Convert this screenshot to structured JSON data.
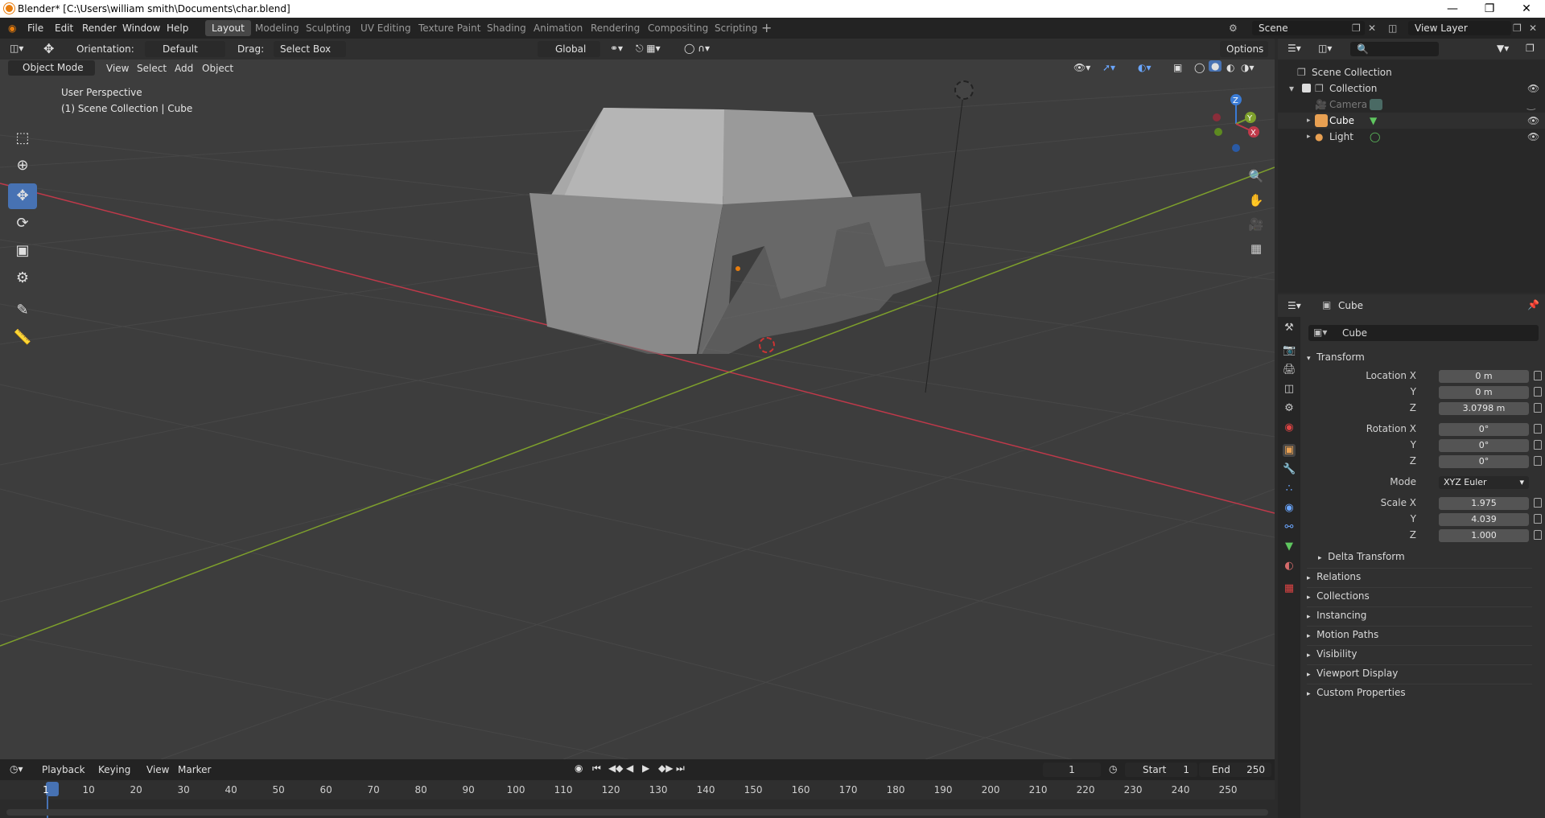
{
  "window": {
    "title": "Blender* [C:\\Users\\william smith\\Documents\\char.blend]"
  },
  "menu": [
    "File",
    "Edit",
    "Render",
    "Window",
    "Help"
  ],
  "workspaces": [
    "Layout",
    "Modeling",
    "Sculpting",
    "UV Editing",
    "Texture Paint",
    "Shading",
    "Animation",
    "Rendering",
    "Compositing",
    "Scripting"
  ],
  "active_workspace": "Layout",
  "scene": {
    "name": "Scene",
    "view_layer": "View Layer"
  },
  "viewport": {
    "orientation_label": "Orientation:",
    "orientation_value": "Default",
    "drag_label": "Drag:",
    "drag_value": "Select Box",
    "transform_space": "Global",
    "options": "Options",
    "mode": "Object Mode",
    "menus": [
      "View",
      "Select",
      "Add",
      "Object"
    ],
    "overlay_line1": "User Perspective",
    "overlay_line2": "(1) Scene Collection | Cube",
    "axis_x": "X",
    "axis_y": "Y",
    "axis_z": "Z"
  },
  "outliner": {
    "root": "Scene Collection",
    "collection": "Collection",
    "items": [
      "Camera",
      "Cube",
      "Light"
    ]
  },
  "properties": {
    "object_name": "Cube",
    "data_name": "Cube",
    "transform_title": "Transform",
    "location_label": "Location X",
    "location": [
      "0 m",
      "0 m",
      "3.0798 m"
    ],
    "rotation_label": "Rotation X",
    "rotation": [
      "0°",
      "0°",
      "0°"
    ],
    "mode_label": "Mode",
    "mode_value": "XYZ Euler",
    "scale_label": "Scale X",
    "scale": [
      "1.975",
      "4.039",
      "1.000"
    ],
    "axis_y": "Y",
    "axis_z": "Z",
    "delta": "Delta Transform",
    "panels": [
      "Relations",
      "Collections",
      "Instancing",
      "Motion Paths",
      "Visibility",
      "Viewport Display",
      "Custom Properties"
    ]
  },
  "timeline": {
    "menus": [
      "Playback",
      "Keying",
      "View",
      "Marker"
    ],
    "current_frame": "1",
    "start_label": "Start",
    "start": "1",
    "end_label": "End",
    "end": "250",
    "ticks": [
      "1",
      "10",
      "20",
      "30",
      "40",
      "50",
      "60",
      "70",
      "80",
      "90",
      "100",
      "110",
      "120",
      "130",
      "140",
      "150",
      "160",
      "170",
      "180",
      "190",
      "200",
      "210",
      "220",
      "230",
      "240",
      "250"
    ]
  },
  "colors": {
    "accent": "#4772b3",
    "x_axis": "#c0394a",
    "y_axis": "#7ea02c",
    "z_axis": "#3a7bd5",
    "orange": "#e87d0d"
  }
}
